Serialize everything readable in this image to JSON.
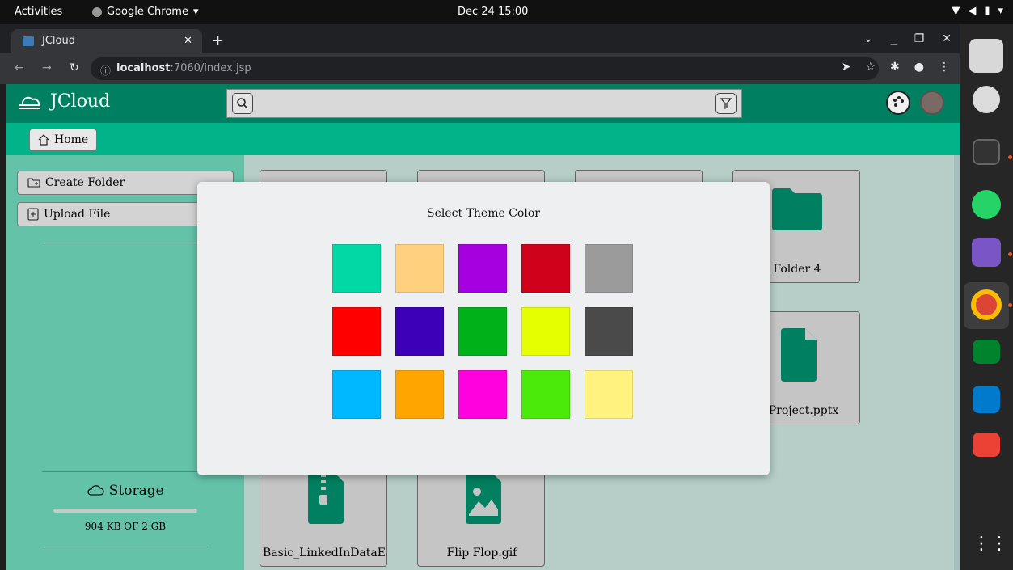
{
  "system": {
    "activities": "Activities",
    "app_name": "Google Chrome",
    "clock": "Dec 24  15:00"
  },
  "browser": {
    "tab_title": "JCloud",
    "url_host": "localhost",
    "url_path": ":7060/index.jsp"
  },
  "app": {
    "brand": "JCloud",
    "search_value": "",
    "home_label": "Home",
    "sidebar": {
      "create_folder": "Create Folder",
      "upload_file": "Upload File",
      "storage_title": "Storage",
      "storage_used": "904 KB OF 2 GB",
      "storage_fraction": 0.0004
    },
    "files": [
      {
        "label": "Folder 4",
        "type": "folder"
      },
      {
        "label": "d_Project.pptx",
        "type": "file"
      },
      {
        "label": "Basic_LinkedInDataE",
        "type": "zip"
      },
      {
        "label": "Flip Flop.gif",
        "type": "image"
      }
    ]
  },
  "modal": {
    "title": "Select Theme Color",
    "colors": [
      "#00d9a6",
      "#ffd17f",
      "#a700e0",
      "#d0021b",
      "#9b9b9b",
      "#ff0000",
      "#3d00b8",
      "#00b21a",
      "#e6ff00",
      "#4a4a4a",
      "#00b8ff",
      "#ffa500",
      "#ff00de",
      "#4cea0a",
      "#fff27f"
    ]
  },
  "theme": {
    "accent": "#008060",
    "accent_light": "#00b388",
    "sidebar_bg": "#64c2a9"
  }
}
